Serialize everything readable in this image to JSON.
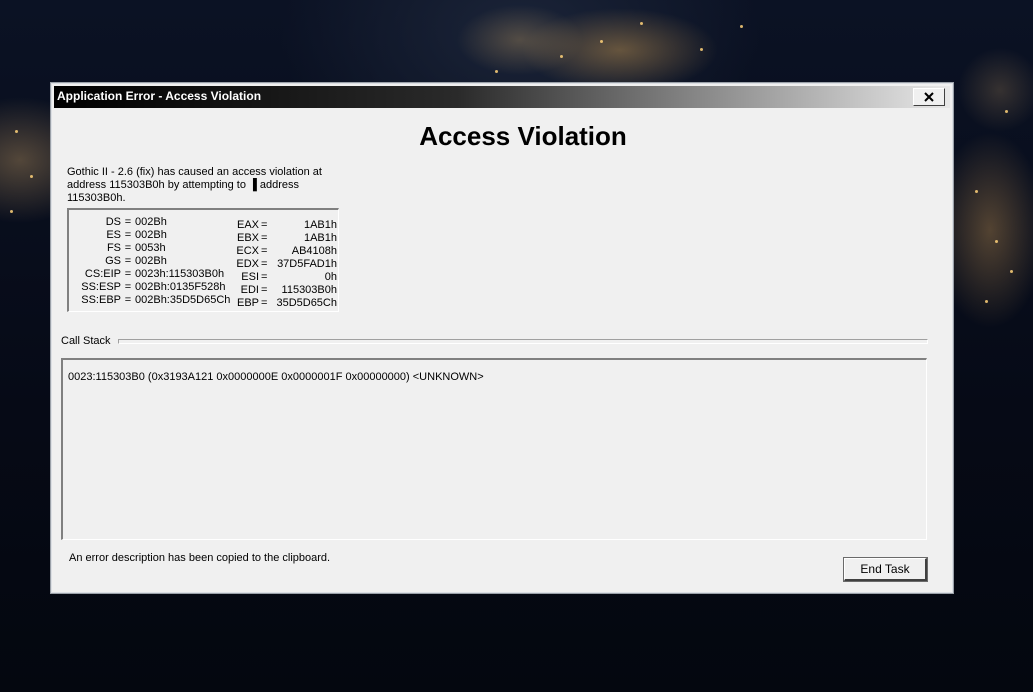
{
  "window": {
    "title": "Application Error - Access Violation"
  },
  "main": {
    "headline": "Access Violation",
    "description": "Gothic II - 2.6 (fix) has caused an access violation at address 115303B0h by attempting to ▐ address 115303B0h."
  },
  "registers": {
    "segment": [
      {
        "name": "DS",
        "value": "002Bh"
      },
      {
        "name": "ES",
        "value": "002Bh"
      },
      {
        "name": "FS",
        "value": "0053h"
      },
      {
        "name": "GS",
        "value": "002Bh"
      },
      {
        "name": "CS:EIP",
        "value": "0023h:115303B0h"
      },
      {
        "name": "SS:ESP",
        "value": "002Bh:0135F528h"
      },
      {
        "name": "SS:EBP",
        "value": "002Bh:35D5D65Ch"
      }
    ],
    "general": [
      {
        "name": "EAX",
        "value": "1AB1h"
      },
      {
        "name": "EBX",
        "value": "1AB1h"
      },
      {
        "name": "ECX",
        "value": "AB4108h"
      },
      {
        "name": "EDX",
        "value": "37D5FAD1h"
      },
      {
        "name": "ESI",
        "value": "0h"
      },
      {
        "name": "EDI",
        "value": "115303B0h"
      },
      {
        "name": "EBP",
        "value": "35D5D65Ch"
      }
    ]
  },
  "callstack": {
    "label": "Call Stack",
    "entries": [
      "0023:115303B0 (0x3193A121 0x0000000E 0x0000001F 0x00000000) <UNKNOWN>"
    ]
  },
  "footer": {
    "status": "An error description has been copied to the clipboard.",
    "end_task_label": "End Task"
  },
  "icons": {
    "close": "close-icon"
  },
  "colors": {
    "dialog_bg": "#f0f0f0",
    "titlebar_start": "#000000",
    "titlebar_end": "#e8e8e8"
  }
}
